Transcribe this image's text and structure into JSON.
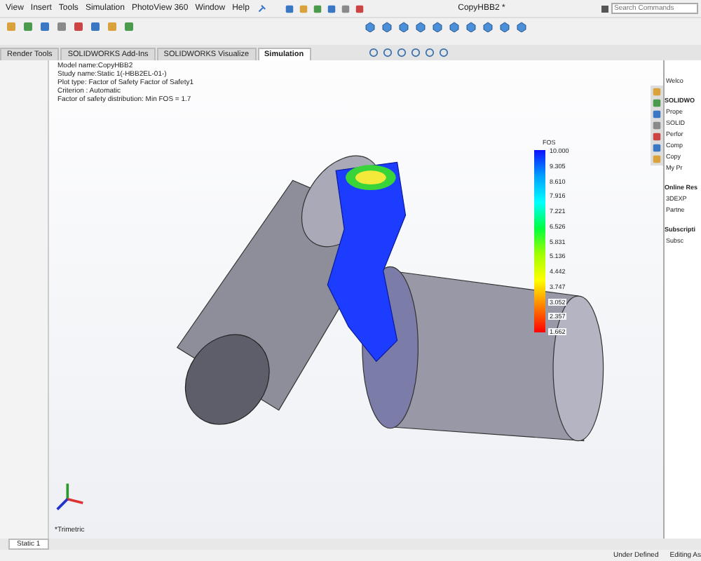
{
  "menu": [
    "View",
    "Insert",
    "Tools",
    "Simulation",
    "PhotoView 360",
    "Window",
    "Help"
  ],
  "window": {
    "title": "CopyHBB2 *"
  },
  "search": {
    "placeholder": "Search Commands"
  },
  "tabs": [
    {
      "label": "Render Tools",
      "selected": false
    },
    {
      "label": "SOLIDWORKS Add-Ins",
      "selected": false
    },
    {
      "label": "SOLIDWORKS Visualize",
      "selected": false
    },
    {
      "label": "Simulation",
      "selected": true
    }
  ],
  "plot_info": [
    "Model name:CopyHBB2",
    "Study name:Static 1(-HBB2EL-01-)",
    "Plot type: Factor of Safety Factor of Safety1",
    "Criterion : Automatic",
    "Factor of safety distribution: Min FOS = 1.7"
  ],
  "legend": {
    "title": "FOS",
    "values": [
      "10.000",
      "9.305",
      "8.610",
      "7.916",
      "7.221",
      "6.526",
      "5.831",
      "5.136",
      "4.442",
      "3.747",
      "3.052",
      "2.357",
      "1.662"
    ]
  },
  "view_label": "*Trimetric",
  "task_pane": {
    "welcome": "Welco",
    "sections": [
      {
        "heading": "SOLIDWO",
        "items": [
          "Prope",
          "SOLID",
          "Perfor",
          "Comp",
          "Copy",
          "My Pr"
        ]
      },
      {
        "heading": "Online Res",
        "items": [
          "3DEXP",
          "Partne"
        ]
      },
      {
        "heading": "Subscripti",
        "items": [
          "Subsc"
        ]
      }
    ]
  },
  "study_tabs": [
    {
      "label": "Static 1",
      "selected": true
    }
  ],
  "status_bar": [
    "Under Defined",
    "Editing As"
  ]
}
